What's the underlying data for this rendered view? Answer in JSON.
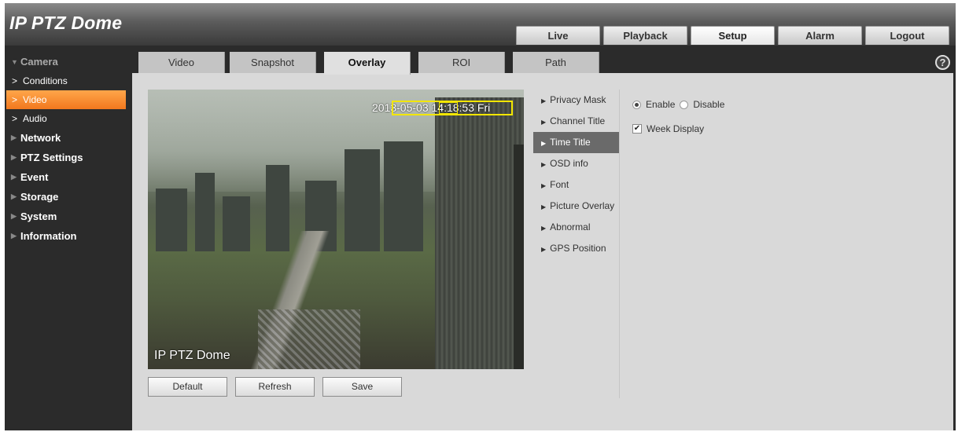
{
  "app": {
    "title": "IP PTZ Dome"
  },
  "top_nav": [
    {
      "label": "Live"
    },
    {
      "label": "Playback"
    },
    {
      "label": "Setup",
      "active": true
    },
    {
      "label": "Alarm"
    },
    {
      "label": "Logout"
    }
  ],
  "sidebar": {
    "camera": "Camera",
    "camera_items": [
      {
        "label": "Conditions"
      },
      {
        "label": "Video",
        "active": true
      },
      {
        "label": "Audio"
      }
    ],
    "network": "Network",
    "ptz_settings": "PTZ Settings",
    "event": "Event",
    "storage": "Storage",
    "system": "System",
    "information": "Information"
  },
  "tabs": [
    {
      "label": "Video"
    },
    {
      "label": "Snapshot"
    },
    {
      "label": "Overlay",
      "active": true
    },
    {
      "label": "ROI"
    },
    {
      "label": "Path"
    }
  ],
  "help_icon": "?",
  "video": {
    "osd_time": "2013-05-03 14:18:53 Fri",
    "osd_channel": "IP PTZ Dome"
  },
  "buttons": {
    "default": "Default",
    "refresh": "Refresh",
    "save": "Save"
  },
  "overlay_menu": [
    {
      "label": "Privacy Mask"
    },
    {
      "label": "Channel Title"
    },
    {
      "label": "Time Title",
      "active": true
    },
    {
      "label": "OSD info"
    },
    {
      "label": "Font"
    },
    {
      "label": "Picture Overlay"
    },
    {
      "label": "Abnormal"
    },
    {
      "label": "GPS Position"
    }
  ],
  "settings": {
    "enable_label": "Enable",
    "disable_label": "Disable",
    "enabled": true,
    "week_display_label": "Week Display",
    "week_display_checked": true
  },
  "colors": {
    "accent": "#f2781e",
    "active_menu": "#6a6a6a",
    "osd_box": "#f2e600"
  }
}
